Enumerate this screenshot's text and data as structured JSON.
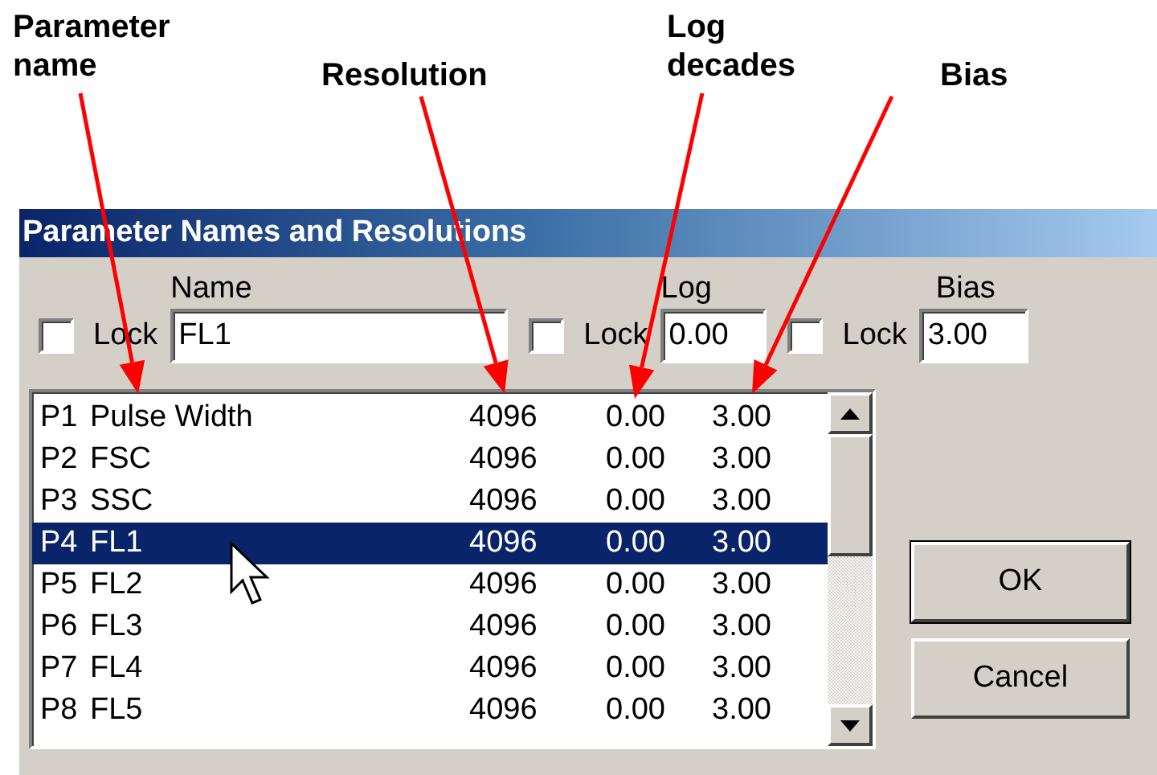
{
  "annotations": [
    {
      "text": "Parameter name"
    },
    {
      "text": "Resolution"
    },
    {
      "text": "Log decades"
    },
    {
      "text": "Bias"
    }
  ],
  "window": {
    "title": "Parameter Names and Resolutions"
  },
  "controls": [
    {
      "lock_label": "Lock",
      "lock_checked": false,
      "label": "Name",
      "value": "FL1"
    },
    {
      "lock_label": "Lock",
      "lock_checked": false,
      "label": "Log",
      "value": "0.00"
    },
    {
      "lock_label": "Lock",
      "lock_checked": false,
      "label": "Bias",
      "value": "3.00"
    }
  ],
  "parameters": [
    {
      "id": "P1",
      "name": "Pulse Width",
      "resolution": "4096",
      "log": "0.00",
      "bias": "3.00",
      "selected": false
    },
    {
      "id": "P2",
      "name": "FSC",
      "resolution": "4096",
      "log": "0.00",
      "bias": "3.00",
      "selected": false
    },
    {
      "id": "P3",
      "name": "SSC",
      "resolution": "4096",
      "log": "0.00",
      "bias": "3.00",
      "selected": false
    },
    {
      "id": "P4",
      "name": "FL1",
      "resolution": "4096",
      "log": "0.00",
      "bias": "3.00",
      "selected": true
    },
    {
      "id": "P5",
      "name": "FL2",
      "resolution": "4096",
      "log": "0.00",
      "bias": "3.00",
      "selected": false
    },
    {
      "id": "P6",
      "name": "FL3",
      "resolution": "4096",
      "log": "0.00",
      "bias": "3.00",
      "selected": false
    },
    {
      "id": "P7",
      "name": "FL4",
      "resolution": "4096",
      "log": "0.00",
      "bias": "3.00",
      "selected": false
    },
    {
      "id": "P8",
      "name": "FL5",
      "resolution": "4096",
      "log": "0.00",
      "bias": "3.00",
      "selected": false
    }
  ],
  "buttons": [
    "OK",
    "Cancel"
  ]
}
